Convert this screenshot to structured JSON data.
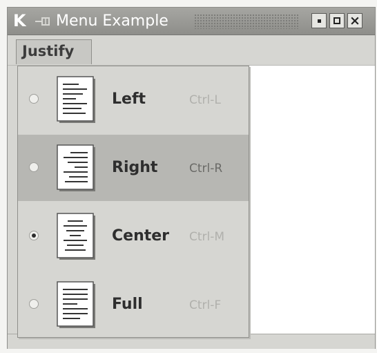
{
  "window": {
    "logo_letter": "K",
    "title": "Menu Example"
  },
  "menubar": {
    "menus": [
      {
        "label": "Justify"
      }
    ]
  },
  "justify_menu": {
    "items": [
      {
        "label": "Left",
        "shortcut": "Ctrl-L",
        "selected": false,
        "highlighted": false,
        "icon": "align-left-icon"
      },
      {
        "label": "Right",
        "shortcut": "Ctrl-R",
        "selected": false,
        "highlighted": true,
        "icon": "align-right-icon"
      },
      {
        "label": "Center",
        "shortcut": "Ctrl-M",
        "selected": true,
        "highlighted": false,
        "icon": "align-center-icon"
      },
      {
        "label": "Full",
        "shortcut": "Ctrl-F",
        "selected": false,
        "highlighted": false,
        "icon": "align-justify-icon"
      }
    ]
  },
  "colors": {
    "titlebar": "#9a9a96",
    "menu_background": "#d6d6d2",
    "highlight": "#b7b7b3"
  }
}
